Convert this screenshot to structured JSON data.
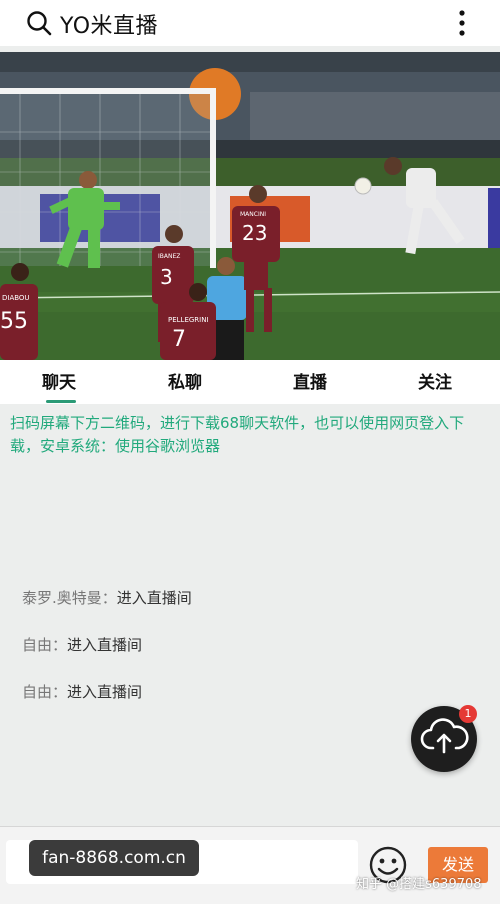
{
  "header": {
    "title": "YO米直播",
    "search_icon": "search-icon",
    "menu_icon": "more-vertical-icon"
  },
  "tabs": [
    {
      "label": "聊天",
      "active": true
    },
    {
      "label": "私聊",
      "active": false
    },
    {
      "label": "直播",
      "active": false
    },
    {
      "label": "关注",
      "active": false
    }
  ],
  "notice": "扫码屏幕下方二维码，进行下载68聊天软件，也可以使用网页登入下载，安卓系统：使用谷歌浏览器",
  "messages": [
    {
      "user": "泰罗.奥特曼：",
      "text": "进入直播间"
    },
    {
      "user": "自由：",
      "text": "进入直播间"
    },
    {
      "user": "自由：",
      "text": "进入直播间"
    }
  ],
  "fab": {
    "icon": "cloud-upload-icon",
    "badge": "1"
  },
  "bottom": {
    "url": "fan-8868.com.cn",
    "emoji_icon": "smiley-icon",
    "send_label": "发送",
    "watermark": "知乎 @搭建s639708"
  },
  "video": {
    "jerseys": [
      "55",
      "3",
      "23",
      "7"
    ],
    "names": [
      "DIABOU",
      "IBANEZ",
      "MANCINI",
      "PELLEGRINI"
    ],
    "colors": {
      "pitch": "#3d6a2e",
      "roma_kit": "#7a1f2a",
      "keeper_kit": "#5fc04e",
      "accent": "#21a97c"
    }
  }
}
